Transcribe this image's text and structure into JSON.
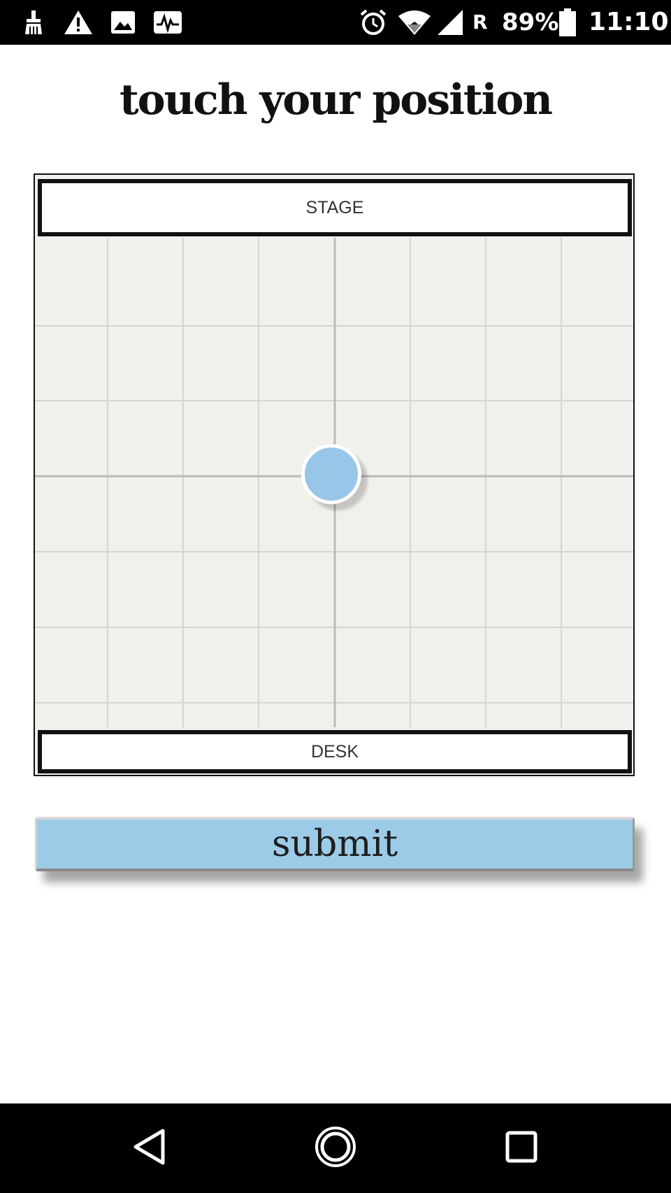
{
  "status_bar": {
    "signal_label": "R",
    "battery_percent": "89%",
    "time": "11:10",
    "icons": [
      "cleaner-icon",
      "warning-icon",
      "image-icon",
      "activity-icon",
      "alarm-icon",
      "wifi-icon",
      "signal-icon",
      "battery-icon"
    ]
  },
  "page": {
    "title": "touch your position"
  },
  "seat_map": {
    "stage_label": "STAGE",
    "desk_label": "DESK",
    "marker_color": "#97c6e8",
    "background_color": "#f1f0ed"
  },
  "submit": {
    "label": "submit",
    "color": "#9ccbe8"
  },
  "nav_bar": {
    "icons": [
      "back-icon",
      "home-icon",
      "recents-icon"
    ]
  }
}
